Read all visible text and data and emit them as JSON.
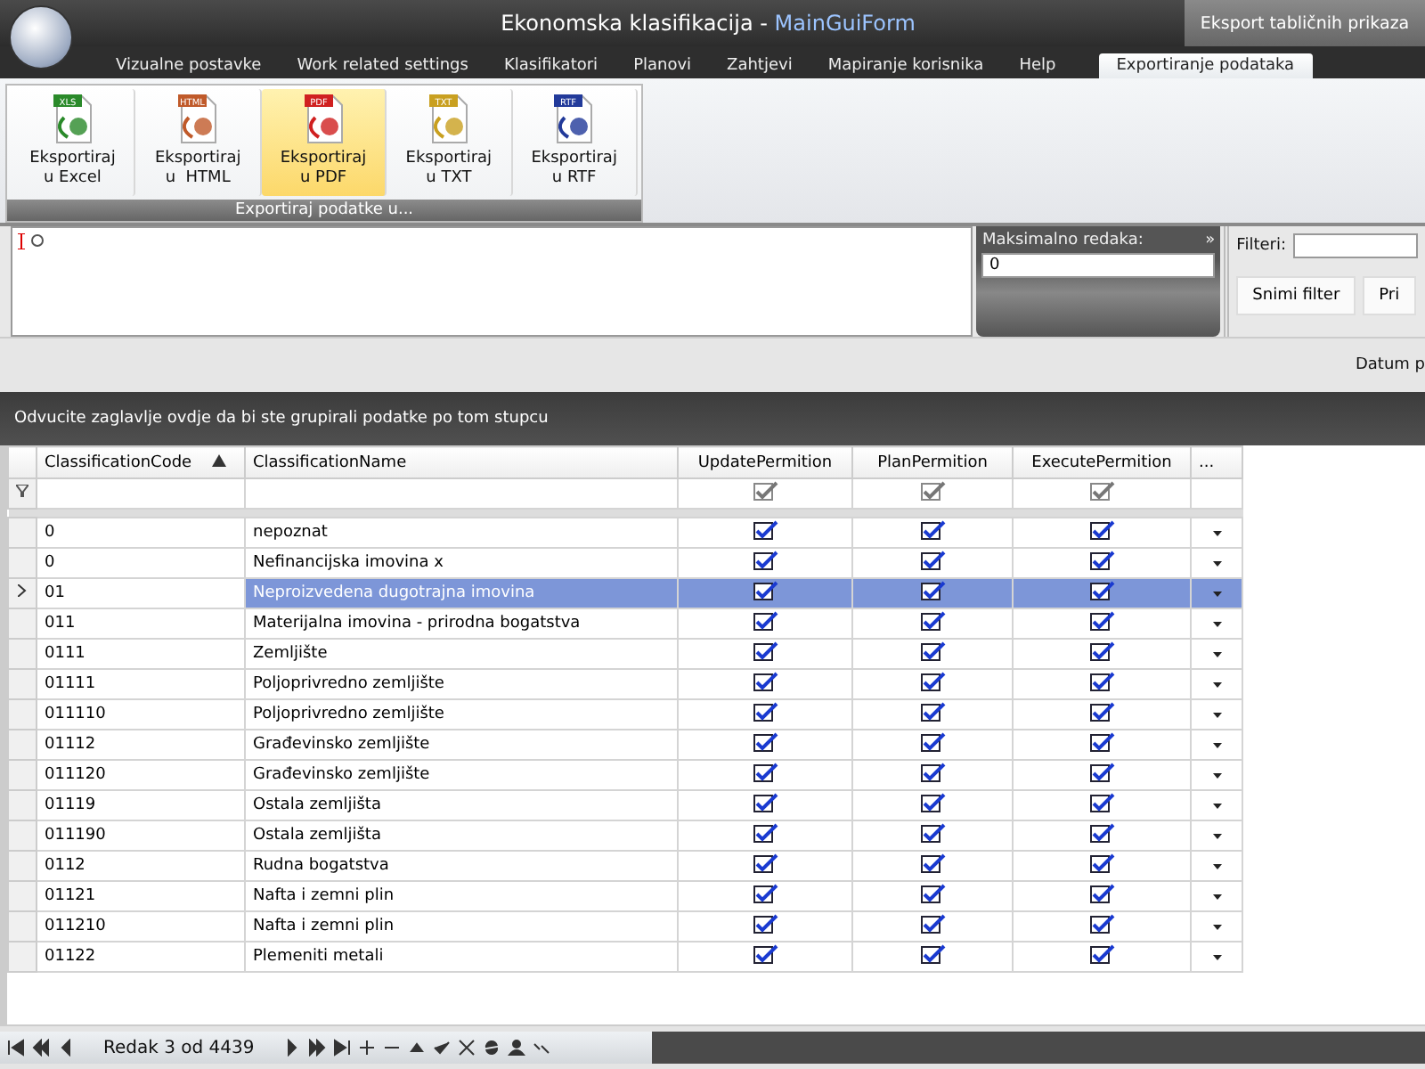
{
  "window": {
    "title": "Ekonomska klasifikacija",
    "separator": "-",
    "form_name": "MainGuiForm",
    "side_tab": "Eksport tabličnih prikaza"
  },
  "menu_tabs": [
    {
      "label": "Vizualne postavke",
      "selected": false
    },
    {
      "label": "Work related settings",
      "selected": false
    },
    {
      "label": "Klasifikatori",
      "selected": false
    },
    {
      "label": "Planovi",
      "selected": false
    },
    {
      "label": "Zahtjevi",
      "selected": false
    },
    {
      "label": "Mapiranje korisnika",
      "selected": false
    },
    {
      "label": "Help",
      "selected": false
    },
    {
      "label": "Exportiranje podataka",
      "selected": true
    }
  ],
  "ribbon": {
    "group_caption": "Exportiraj podatke u...",
    "buttons": [
      {
        "kind": "xls",
        "badge": "XLS",
        "label": "Eksportiraj\nu Excel",
        "selected": false
      },
      {
        "kind": "html",
        "badge": "HTML",
        "label": "Eksportiraj\nu  HTML",
        "selected": false
      },
      {
        "kind": "pdf",
        "badge": "PDF",
        "label": "Eksportiraj\nu PDF",
        "selected": true
      },
      {
        "kind": "txt",
        "badge": "TXT",
        "label": "Eksportiraj\nu TXT",
        "selected": false
      },
      {
        "kind": "rtf",
        "badge": "RTF",
        "label": "Eksportiraj\nu RTF",
        "selected": false
      }
    ]
  },
  "max_rows": {
    "label": "Maksimalno redaka:",
    "expand": "»",
    "value": "0"
  },
  "filter_panel": {
    "label": "Filteri:",
    "buttons": [
      "Snimi filter",
      "Pri"
    ]
  },
  "date_label": "Datum p",
  "group_hint": "Odvucite zaglavlje ovdje da bi ste grupirali podatke po tom stupcu",
  "table": {
    "columns": [
      {
        "label": "ClassificationCode",
        "sorted": true
      },
      {
        "label": "ClassificationName",
        "sorted": false
      },
      {
        "label": "UpdatePermition",
        "sorted": false
      },
      {
        "label": "PlanPermition",
        "sorted": false
      },
      {
        "label": "ExecutePermition",
        "sorted": false
      },
      {
        "label": "...",
        "sorted": false
      }
    ],
    "filter_row": [
      {
        "checked": true
      },
      {
        "checked": true
      },
      {
        "checked": true
      }
    ],
    "rows": [
      {
        "code": "0",
        "name": "nepoznat",
        "update": true,
        "plan": true,
        "execute": true,
        "selected": false
      },
      {
        "code": "0",
        "name": "Nefinancijska imovina x",
        "update": true,
        "plan": true,
        "execute": true,
        "selected": false
      },
      {
        "code": "01",
        "name": "Neproizvedena dugotrajna imovina",
        "update": true,
        "plan": true,
        "execute": true,
        "selected": true
      },
      {
        "code": "011",
        "name": "Materijalna imovina - prirodna bogatstva",
        "update": true,
        "plan": true,
        "execute": true,
        "selected": false
      },
      {
        "code": "0111",
        "name": "Zemljište",
        "update": true,
        "plan": true,
        "execute": true,
        "selected": false
      },
      {
        "code": "01111",
        "name": "Poljoprivredno zemljište",
        "update": true,
        "plan": true,
        "execute": true,
        "selected": false
      },
      {
        "code": "011110",
        "name": "Poljoprivredno zemljište",
        "update": true,
        "plan": true,
        "execute": true,
        "selected": false
      },
      {
        "code": "01112",
        "name": "Građevinsko zemljište",
        "update": true,
        "plan": true,
        "execute": true,
        "selected": false
      },
      {
        "code": "011120",
        "name": "Građevinsko zemljište",
        "update": true,
        "plan": true,
        "execute": true,
        "selected": false
      },
      {
        "code": "01119",
        "name": "Ostala zemljišta",
        "update": true,
        "plan": true,
        "execute": true,
        "selected": false
      },
      {
        "code": "011190",
        "name": "Ostala zemljišta",
        "update": true,
        "plan": true,
        "execute": true,
        "selected": false
      },
      {
        "code": "0112",
        "name": "Rudna bogatstva",
        "update": true,
        "plan": true,
        "execute": true,
        "selected": false
      },
      {
        "code": "01121",
        "name": "Nafta i zemni plin",
        "update": true,
        "plan": true,
        "execute": true,
        "selected": false
      },
      {
        "code": "011210",
        "name": "Nafta i zemni plin",
        "update": true,
        "plan": true,
        "execute": true,
        "selected": false
      },
      {
        "code": "01122",
        "name": "Plemeniti metali",
        "update": true,
        "plan": true,
        "execute": true,
        "selected": false
      }
    ]
  },
  "navigator": {
    "position": "Redak 3 od 4439"
  }
}
